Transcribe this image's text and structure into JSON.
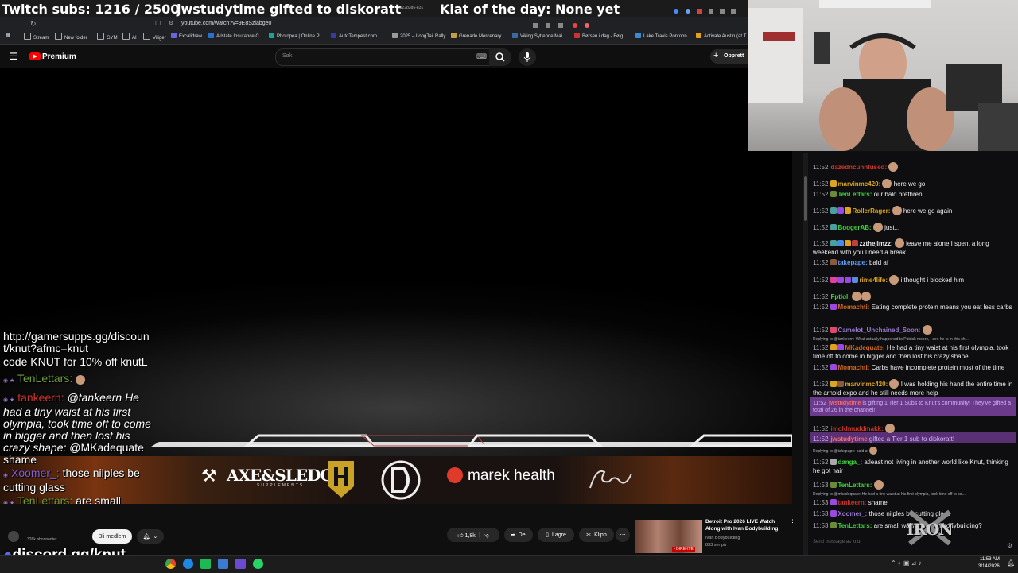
{
  "overlay": {
    "subs": "Twitch subs: 1216 / 2500",
    "gifted": "jwstudytime gifted to diskoratt",
    "klat": "Klat of the day: None yet"
  },
  "browser": {
    "url": "youtube.com/watch?v=9E8Sziabge0",
    "tab_label": "3a22b3d6-831",
    "bookmarks": [
      "Stream",
      "New folder",
      "GYM",
      "AI",
      "Viliger",
      "Excalidraw",
      "Allstate Insurance C...",
      "Photopea | Online P...",
      "AutoTempest.com...",
      "2025 – LongTail Rally",
      "Grenade Mercenary...",
      "Viking Syttende Mai...",
      "Børsen i dag - Følg...",
      "Lake Travis Pontoon...",
      "Activate Austin (at T..."
    ]
  },
  "yt_header": {
    "logo_text": "Premium",
    "search_placeholder": "Søk",
    "create_label": "Opprett"
  },
  "left_chat": {
    "promo1": "http://gamersupps.gg/discount/knut?afmc=knut",
    "promo2": "code KNUT for 10% off knutL",
    "u1": "TenLettars:",
    "u2": "tankeern:",
    "m2": "@tankeern He had a tiny waist at his first olympia, took time off to come in bigger and then lost his crazy shape:",
    "m2b": "@MKadequate shame",
    "u3": "Xoomer_:",
    "m3": "those niiples be cutting glass",
    "u4": "TenLettars:",
    "m4": "are small waists ideal in bodybuilding?",
    "discord": "discord.gg/knut"
  },
  "below_video": {
    "channel_subs": "326k abonnenter",
    "join_label": "Bli medlem",
    "likes": "1,8k",
    "share_label": "Del",
    "save_label": "Lagre",
    "clip_label": "Klipp",
    "next_title": "Detroit Pro 2026 LIVE Watch Along with Ivan Bodybuilding",
    "next_channel": "Ivan Bodybuilding",
    "next_views": "833 ser på",
    "live_badge": "• DIREKTE"
  },
  "right_chat": {
    "messages": [
      {
        "time": "11:52",
        "user": "dazedncunnfused:",
        "text": "",
        "color": "#d0342c"
      },
      {
        "time": "11:52",
        "user": "marvinmc420:",
        "text": "here we go",
        "color": "#daa520"
      },
      {
        "time": "11:52",
        "user": "TenLettars:",
        "text": "our bald brethren",
        "color": "#3bd63b"
      },
      {
        "time": "11:52",
        "user": "RollerRager:",
        "text": "here we go again",
        "color": "#daa520"
      },
      {
        "time": "11:52",
        "user": "BoogerAB:",
        "text": "just...",
        "color": "#3bd63b"
      },
      {
        "time": "11:52",
        "user": "zzthejimzz:",
        "text": "leave me alone I spent a long weekend with you I need a break",
        "color": "#efeff1"
      },
      {
        "time": "11:52",
        "user": "takepape:",
        "text": "bald af",
        "color": "#5aa0ff"
      },
      {
        "time": "11:52",
        "user": "rime4life:",
        "text": "i thought i blocked him",
        "color": "#daa520"
      },
      {
        "time": "11:52",
        "user": "Fptlol:",
        "text": "",
        "color": "#3bd63b"
      },
      {
        "time": "11:52",
        "user": "Momachti:",
        "text": "Eating complete protein means you eat less carbs",
        "color": "#d2691e"
      },
      {
        "time": "11:52",
        "user": "Camelot_Unchained_Soon:",
        "text": "",
        "color": "#9a7ad0"
      },
      {
        "time": "",
        "user": "",
        "text": "Replying to @tankeern: What actually happened to Patrick moore, i see he is in this sh...",
        "color": "#adadb8"
      },
      {
        "time": "11:52",
        "user": "MKadequate:",
        "text": "He had a tiny waist at his first olympia, took time off to come in bigger and then lost his crazy shape",
        "color": "#d2691e"
      },
      {
        "time": "11:52",
        "user": "Momachti:",
        "text": "Carbs have incomplete protein most of the time",
        "color": "#d2691e"
      },
      {
        "time": "11:52",
        "user": "marvinmc420:",
        "text": "I was holding his hand the entire time in the arnold expo and he still needs more help",
        "color": "#daa520"
      },
      {
        "time": "11:52",
        "user": "jwstudytime",
        "text": "is gifting 1 Tier 1 Subs to Knut's community! They've gifted a total of 26 in the channel!",
        "color": "#d2b3ff"
      },
      {
        "time": "11:52",
        "user": "imoldmuddmakk:",
        "text": "",
        "color": "#d0342c"
      },
      {
        "time": "11:52",
        "user": "jwstudytime",
        "text": "gifted a Tier 1 sub to diskoratt!",
        "color": "#d2b3ff"
      },
      {
        "time": "",
        "user": "",
        "text": "Replying to @takepape: bald af",
        "color": "#adadb8"
      },
      {
        "time": "11:52",
        "user": "danga_:",
        "text": "atleast not living in another world like Knut, thinking he got hair",
        "color": "#3bd63b"
      },
      {
        "time": "11:53",
        "user": "TenLettars:",
        "text": "",
        "color": "#3bd63b"
      },
      {
        "time": "",
        "user": "",
        "text": "Replying to @mkadequate: He had a tiny waist at his first olympia, took time off to co...",
        "color": "#adadb8"
      },
      {
        "time": "11:53",
        "user": "tankeern:",
        "text": "shame",
        "color": "#d0342c"
      },
      {
        "time": "11:53",
        "user": "Xoomer_:",
        "text": "those niiples be cutting glass",
        "color": "#9a7ad0"
      },
      {
        "time": "11:53",
        "user": "TenLettars:",
        "text": "are small waists ideal in bodybuilding?",
        "color": "#3bd63b"
      }
    ],
    "input_placeholder": "Send message as knut"
  },
  "taskbar": {
    "time": "11:53 AM",
    "date": "3/14/2026"
  },
  "brand": {
    "axe": "AXE&SLEDGE",
    "axe_sub": "SUPPLEMENTS",
    "marek": "marek health",
    "iron": "IRON"
  }
}
